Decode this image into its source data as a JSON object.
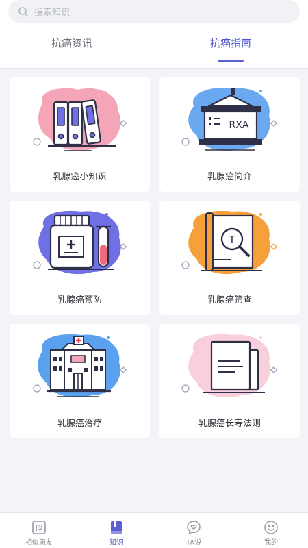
{
  "search": {
    "placeholder": "搜索知识"
  },
  "tabs": [
    {
      "label": "抗癌资讯",
      "active": false
    },
    {
      "label": "抗癌指南",
      "active": true
    }
  ],
  "cards": [
    {
      "title": "乳腺癌小知识",
      "icon": "binders-icon",
      "blob_color": "#f4a6b8"
    },
    {
      "title": "乳腺癌简介",
      "icon": "board-rxa-icon",
      "board_text": "RXA",
      "blob_color": "#6aa8f0"
    },
    {
      "title": "乳腺癌预防",
      "icon": "medicine-bottle-icon",
      "blob_color": "#6f70e6"
    },
    {
      "title": "乳腺癌筛查",
      "icon": "magnifier-document-icon",
      "blob_color": "#f6a03c"
    },
    {
      "title": "乳腺癌治疗",
      "icon": "hospital-icon",
      "blob_color": "#5aa2ef"
    },
    {
      "title": "乳腺癌长寿法则",
      "icon": "document-stack-icon",
      "blob_color": "#f9cfdc"
    }
  ],
  "tabbar": [
    {
      "label": "相似患友",
      "icon": "similar-icon",
      "active": false
    },
    {
      "label": "知识",
      "icon": "book-icon",
      "active": true
    },
    {
      "label": "TA说",
      "icon": "heart-chat-icon",
      "active": false
    },
    {
      "label": "我的",
      "icon": "smile-icon",
      "active": false
    }
  ],
  "colors": {
    "accent": "#4e56c9",
    "background": "#f3f4f8",
    "outline": "#2f3047"
  }
}
